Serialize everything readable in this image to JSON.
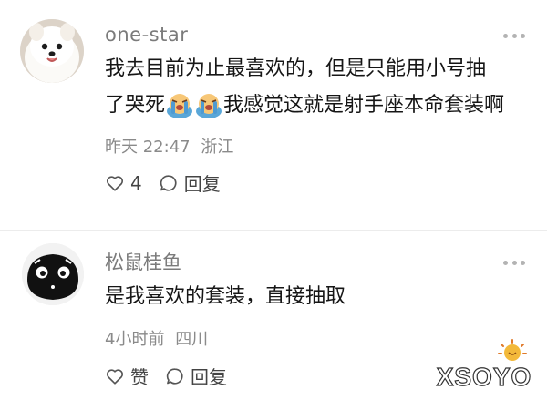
{
  "comments": [
    {
      "username": "one-star",
      "avatar": "white-pomeranian-dog",
      "text_line1": "我去目前为止最喜欢的，但是只能用小号抽",
      "text_line2_a": "了哭死",
      "text_line2_emoji": [
        "crying-face-emoji",
        "crying-face-emoji"
      ],
      "text_line2_b": "我感觉这就是射手座本命套装啊",
      "time": "昨天 22:47",
      "location": "浙江",
      "like_count": "4",
      "reply_label": "回复"
    },
    {
      "username": "松鼠桂鱼",
      "avatar": "black-cartoon-creature",
      "text_line1": "是我喜欢的套装，直接抽取",
      "time": "4小时前",
      "location": "四川",
      "like_label": "赞",
      "reply_label": "回复"
    }
  ],
  "watermark": {
    "text": "XSOYO",
    "icon": "smiling-sun-icon"
  },
  "colors": {
    "username": "#7b7b7b",
    "meta": "#8a8a8a",
    "text": "#161616",
    "watermark": "#ffffff"
  }
}
